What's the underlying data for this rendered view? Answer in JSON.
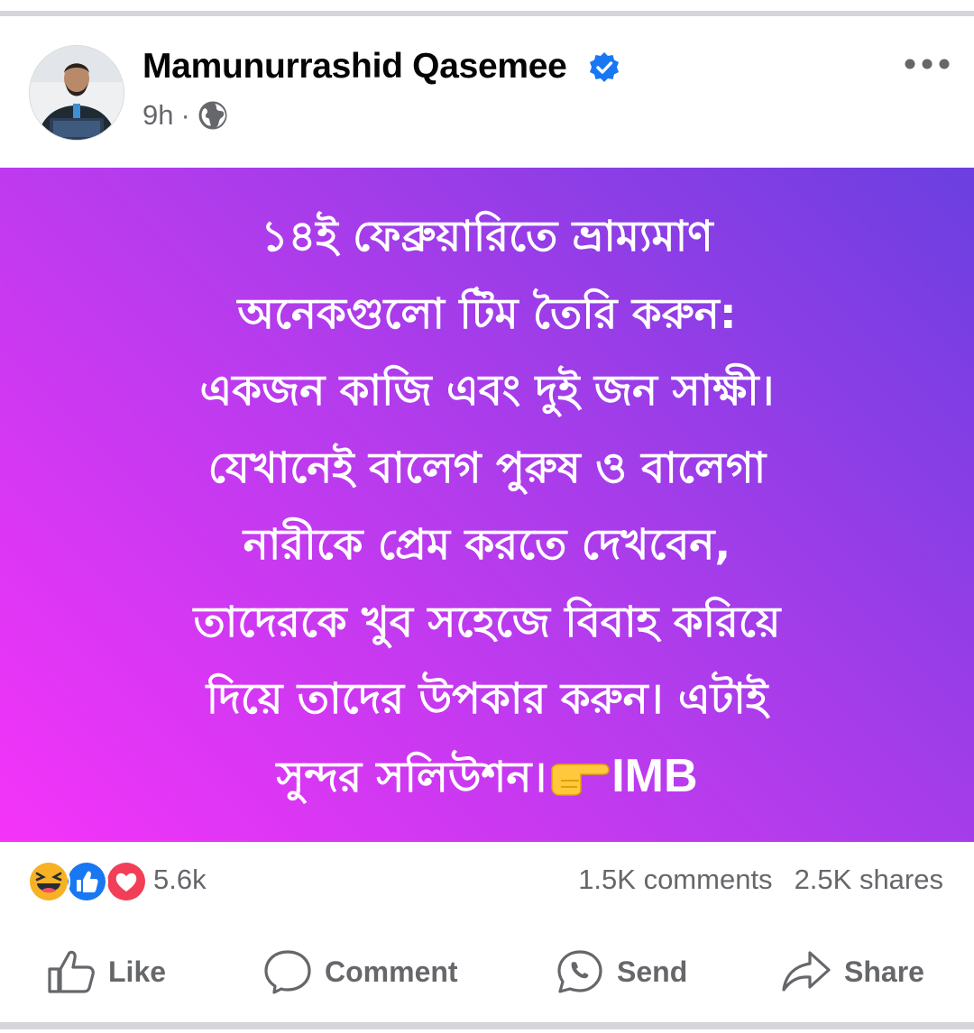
{
  "post": {
    "author_name": "Mamunurrashid Qasemee",
    "time": "9h",
    "separator": "·",
    "audience_icon": "globe-icon",
    "verified_icon": "verified-badge-icon",
    "more_icon": "more-options-icon",
    "background": {
      "gradient_start": "#f533f9",
      "gradient_end": "#6b3fe0"
    },
    "text_lines": [
      "১৪ই ফেব্রুয়ারিতে ভ্রাম্যমাণ",
      "অনেকগুলো টিম তৈরি করুন:",
      "একজন কাজি এবং দুই জন সাক্ষী।",
      "যেখানেই বালেগ পুরুষ ও বালেগা",
      "নারীকে প্রেম করতে দেখবেন,",
      "তাদেরকে খুব সহেজে বিবাহ করিয়ে",
      "দিয়ে তাদের উপকার করুন। এটাই"
    ],
    "last_line_text": "সুন্দর সলিউশন।",
    "last_line_emoji": "backhand-index-pointing-right-icon",
    "signature": "IMB"
  },
  "stats": {
    "reactions": [
      "haha-icon",
      "like-icon",
      "love-icon"
    ],
    "reaction_count": "5.6k",
    "comments": "1.5K comments",
    "shares": "2.5K shares"
  },
  "actions": {
    "like": "Like",
    "comment": "Comment",
    "send": "Send",
    "share": "Share"
  },
  "colors": {
    "facebook_blue": "#1877f2",
    "muted_text": "#65676b",
    "love_red": "#f33e58",
    "haha_yellow": "#f7b125"
  }
}
